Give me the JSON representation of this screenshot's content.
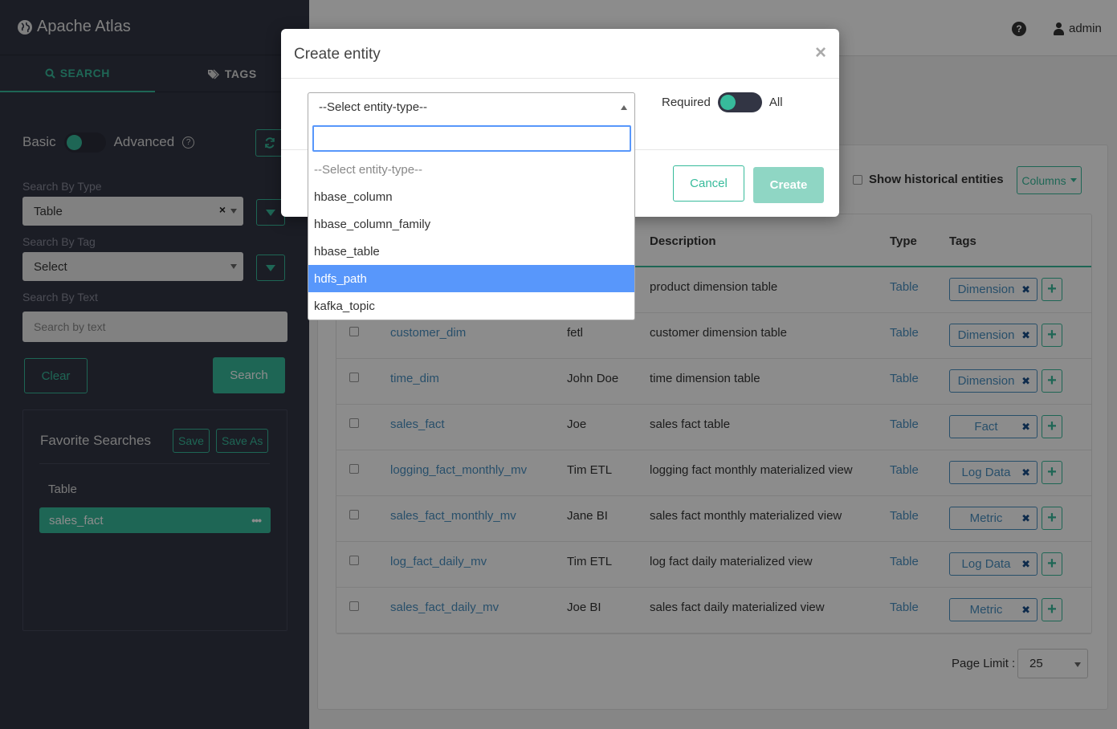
{
  "brand": "Apache Atlas",
  "sidebar": {
    "tabs": [
      {
        "label": "SEARCH",
        "active": true
      },
      {
        "label": "TAGS",
        "active": false
      }
    ],
    "mode_basic": "Basic",
    "mode_advanced": "Advanced",
    "search_by_type_label": "Search By Type",
    "type_value": "Table",
    "search_by_tag_label": "Search By Tag",
    "tag_value": "Select",
    "search_by_text_label": "Search By Text",
    "text_placeholder": "Search by text",
    "clear_label": "Clear",
    "search_label": "Search",
    "favorites": {
      "title": "Favorite Searches",
      "save_label": "Save",
      "save_as_label": "Save As",
      "group": "Table",
      "items": [
        "sales_fact"
      ]
    }
  },
  "header": {
    "user": "admin"
  },
  "toolbar": {
    "show_historical": "Show historical entities",
    "columns_label": "Columns"
  },
  "table": {
    "headers": {
      "description": "Description",
      "type": "Type",
      "tags": "Tags"
    },
    "rows": [
      {
        "name": "",
        "owner": "",
        "description": "product dimension table",
        "type": "Table",
        "tag": "Dimension"
      },
      {
        "name": "customer_dim",
        "owner": "fetl",
        "description": "customer dimension table",
        "type": "Table",
        "tag": "Dimension"
      },
      {
        "name": "time_dim",
        "owner": "John Doe",
        "description": "time dimension table",
        "type": "Table",
        "tag": "Dimension"
      },
      {
        "name": "sales_fact",
        "owner": "Joe",
        "description": "sales fact table",
        "type": "Table",
        "tag": "Fact"
      },
      {
        "name": "logging_fact_monthly_mv",
        "owner": "Tim ETL",
        "description": "logging fact monthly materialized view",
        "type": "Table",
        "tag": "Log Data"
      },
      {
        "name": "sales_fact_monthly_mv",
        "owner": "Jane BI",
        "description": "sales fact monthly materialized view",
        "type": "Table",
        "tag": "Metric"
      },
      {
        "name": "log_fact_daily_mv",
        "owner": "Tim ETL",
        "description": "log fact daily materialized view",
        "type": "Table",
        "tag": "Log Data"
      },
      {
        "name": "sales_fact_daily_mv",
        "owner": "Joe BI",
        "description": "sales fact daily materialized view",
        "type": "Table",
        "tag": "Metric"
      }
    ]
  },
  "pagination": {
    "page_limit_label": "Page Limit :",
    "page_limit_value": "25"
  },
  "modal": {
    "title": "Create entity",
    "close_glyph": "×",
    "select_value": "--Select entity-type--",
    "required_label": "Required",
    "all_label": "All",
    "cancel_label": "Cancel",
    "create_label": "Create",
    "options": [
      {
        "label": "--Select entity-type--",
        "placeholder": true
      },
      {
        "label": "hbase_column"
      },
      {
        "label": "hbase_column_family"
      },
      {
        "label": "hbase_table"
      },
      {
        "label": "hdfs_path",
        "highlighted": true
      },
      {
        "label": "kafka_topic"
      }
    ]
  },
  "colors": {
    "accent": "#37bb9b",
    "sidebar_bg": "#323544",
    "link": "#4a90c2",
    "highlight": "#5897fb"
  }
}
